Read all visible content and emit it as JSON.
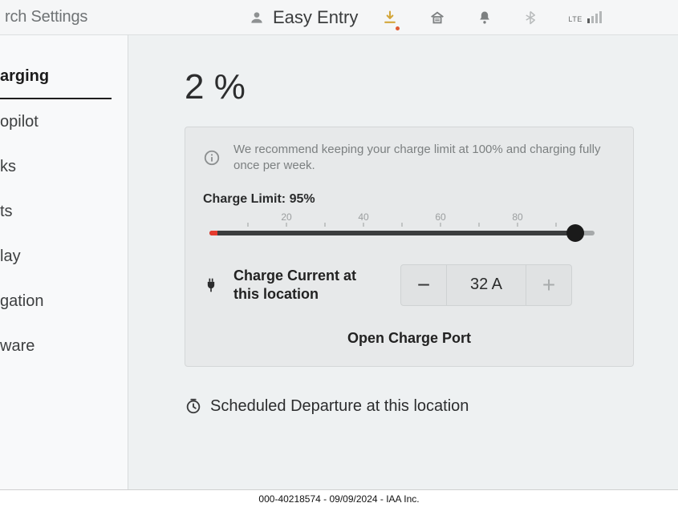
{
  "topbar": {
    "search_text": "rch Settings",
    "profile_name": "Easy Entry",
    "lte_label": "LTE"
  },
  "sidebar": {
    "items": [
      {
        "label": "arging"
      },
      {
        "label": "opilot"
      },
      {
        "label": "ks"
      },
      {
        "label": "ts"
      },
      {
        "label": "lay"
      },
      {
        "label": "gation"
      },
      {
        "label": "ware"
      }
    ]
  },
  "main": {
    "battery_percent": "2 %",
    "info_message": "We recommend keeping your charge limit at 100% and charging fully once per week.",
    "charge_limit_label": "Charge Limit: 95%",
    "ticks": {
      "t20": "20",
      "t40": "40",
      "t60": "60",
      "t80": "80"
    },
    "charge_current_label": "Charge Current at this location",
    "charge_current_value": "32  A",
    "minus": "−",
    "plus": "+",
    "open_port_label": "Open Charge Port",
    "scheduled_label": "Scheduled Departure at this location"
  },
  "caption": "000-40218574 - 09/09/2024 - IAA Inc."
}
